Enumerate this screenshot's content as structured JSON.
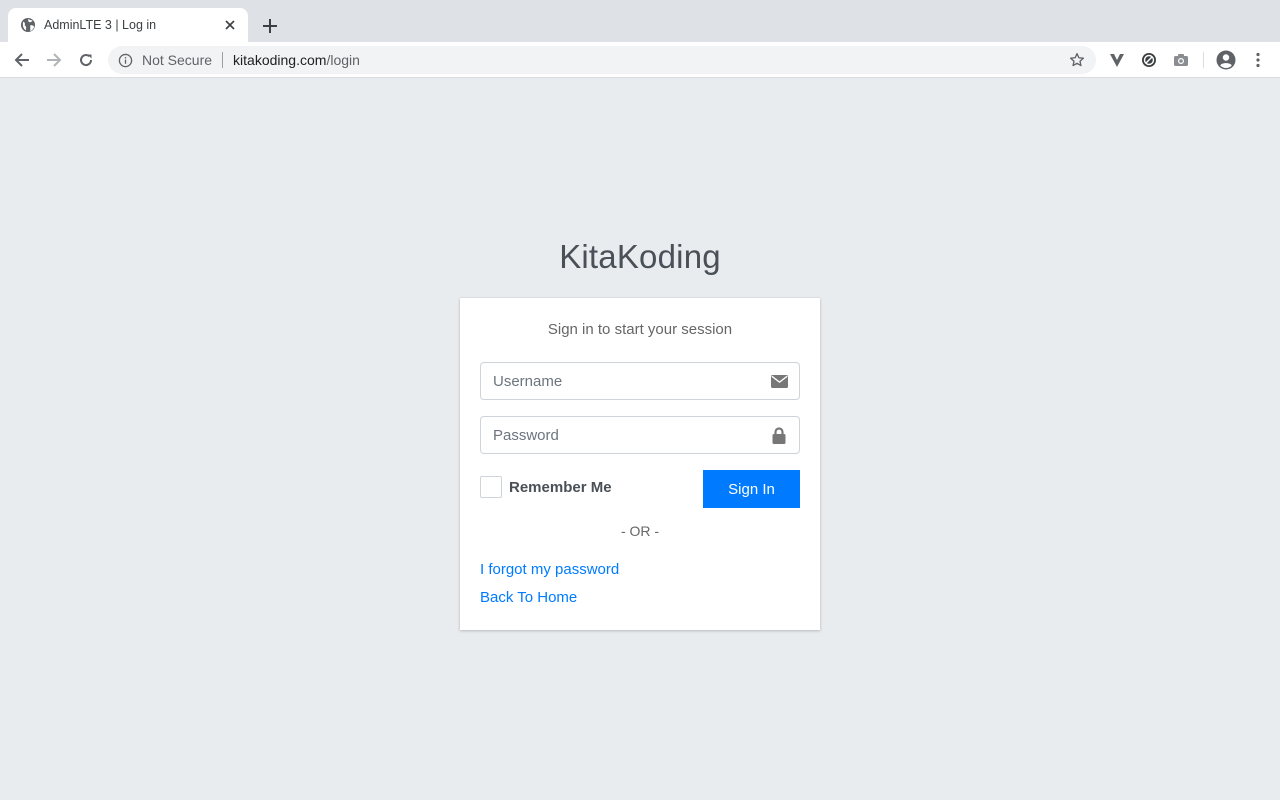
{
  "browser": {
    "tab_title": "AdminLTE 3 | Log in",
    "security_label": "Not Secure",
    "url_host": "kitakoding.com",
    "url_path": "/login"
  },
  "page": {
    "logo_text": "KitaKoding",
    "login_message": "Sign in to start your session",
    "username_placeholder": "Username",
    "password_placeholder": "Password",
    "remember_label": "Remember Me",
    "sign_in_label": "Sign In",
    "or_text": "- OR -",
    "forgot_link": "I forgot my password",
    "home_link": "Back To Home"
  },
  "icons": {
    "favicon": "globe-icon",
    "username_field": "envelope-icon",
    "password_field": "lock-icon"
  },
  "colors": {
    "primary": "#007bff",
    "background": "#e9ecef"
  }
}
